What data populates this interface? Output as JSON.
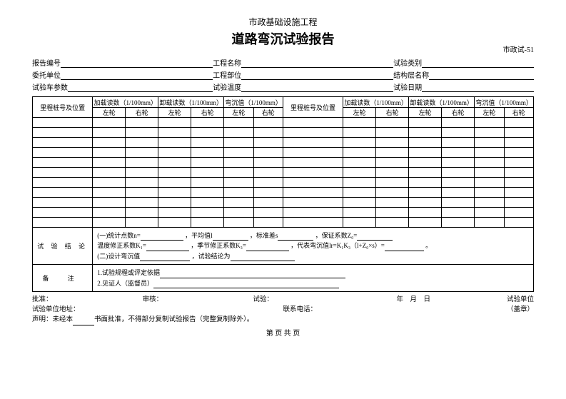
{
  "header": {
    "subtitle": "市政基础设施工程",
    "title": "道路弯沉试验报告",
    "doc_number": "市政试-51"
  },
  "meta": {
    "row1": {
      "a": "报告编号",
      "b": "工程名称",
      "c": "试验类别"
    },
    "row2": {
      "a": "委托单位",
      "b": "工程部位",
      "c": "结构层名称"
    },
    "row3": {
      "a": "试验车参数",
      "b": "试验温度",
      "c": "试验日期"
    }
  },
  "table": {
    "col_station": "里程桩号及位置",
    "col_load": "加载读数（1/100mm）",
    "col_unload": "卸载读数（1/100mm）",
    "col_deflection": "弯沉值（1/100mm）",
    "left_wheel": "左轮",
    "right_wheel": "右轮"
  },
  "conclusion": {
    "label": "试 验 结 论",
    "line1a": "(一)统计点数n=",
    "line1b": "，平均值l",
    "line1c": "，标准差s",
    "line1d": "，保证系数Z₀=",
    "line2a": "温度修正系数K₁=",
    "line2b": "，季节修正系数K₃=",
    "line2c": "，代表弯沉值lr=K₁K₃（l+Z₀×s）=",
    "line2d": "。",
    "line3a": "(二)设计弯沉值",
    "line3b": "，试验结论为"
  },
  "remarks": {
    "label": "备    注",
    "line1": "1.试验规程或评定依据",
    "line2": "2.见证人（监督员）"
  },
  "footer": {
    "approve": "批准：",
    "review": "审核：",
    "test": "试验：",
    "year": "年",
    "month": "月",
    "day": "日",
    "unit_label": "试验单位",
    "seal": "（盖章）",
    "addr": "试验单位地址：",
    "phone": "联系电话：",
    "disclaimer_a": "声明：未经本",
    "disclaimer_b": "书面批准，不得部分复制试验报告（完整复制除外）。",
    "pager": "第  页  共  页"
  }
}
